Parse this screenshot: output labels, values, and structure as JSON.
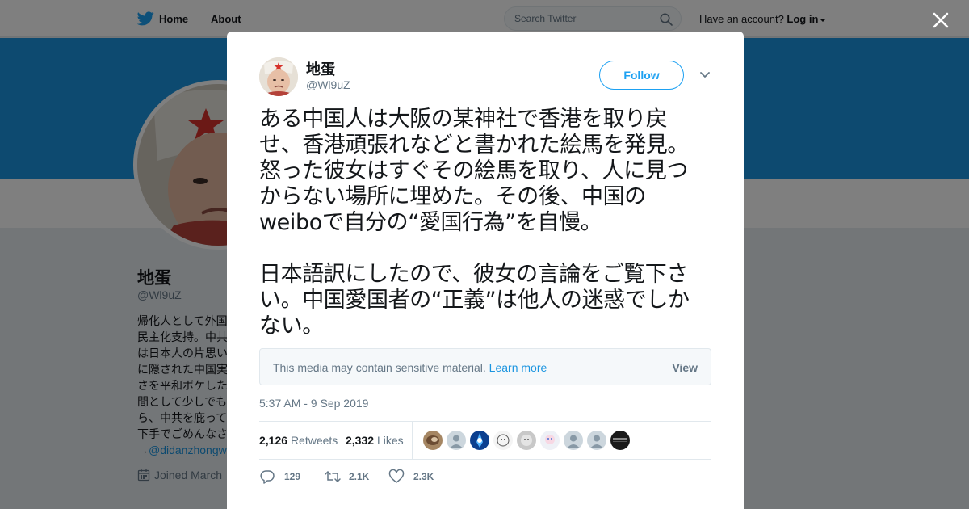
{
  "nav": {
    "home": "Home",
    "about": "About",
    "search_placeholder": "Search Twitter",
    "have_account": "Have an account?",
    "login": "Log in"
  },
  "profile": {
    "name": "地蛋",
    "handle": "@Wl9uZ",
    "bio_lines": [
      "帰化人として外国",
      "民主化支持。中共",
      "は日本人の片思い",
      "に隠された中国実",
      "さを平和ボケした",
      "間として少しでも",
      "ら、中共を庇って",
      "下手でごめんなさ"
    ],
    "bio_link_prefix": "→",
    "bio_link": "@didanzhongw",
    "joined": "Joined March"
  },
  "tweet": {
    "author_name": "地蛋",
    "author_handle": "@Wl9uZ",
    "follow_label": "Follow",
    "lines_para1": [
      "ある中国人は大阪の某神社で香港を取り戻",
      "せ、香港頑張れなどと書かれた絵馬を発見。",
      "怒った彼女はすぐその絵馬を取り、人に見つ",
      "からない場所に埋めた。その後、中国の",
      "weiboで自分の“愛国行為”を自慢。"
    ],
    "lines_para2": [
      "日本語訳にしたので、彼女の言論をご覧下さ",
      "い。中国愛国者の“正義”は他人の迷惑でしか",
      "ない。"
    ],
    "sensitive_notice": "This media may contain sensitive material.",
    "learn_more": "Learn more",
    "view_label": "View",
    "timestamp": "5:37 AM - 9 Sep 2019",
    "retweets_count": "2,126",
    "retweets_label": "Retweets",
    "likes_count": "2,332",
    "likes_label": "Likes",
    "replies_action": "129",
    "retweets_action": "2.1K",
    "likes_action": "2.3K"
  },
  "liker_avatars": [
    {
      "kind": "photo",
      "color": "#8a6a4a"
    },
    {
      "kind": "default",
      "color": "#aab8c2"
    },
    {
      "kind": "blue",
      "color": "#1a6fd6"
    },
    {
      "kind": "sketch",
      "color": "#f0f0f0"
    },
    {
      "kind": "grey",
      "color": "#c9c9c9"
    },
    {
      "kind": "anime",
      "color": "#e8e3f0"
    },
    {
      "kind": "default",
      "color": "#aab8c2"
    },
    {
      "kind": "default",
      "color": "#aab8c2"
    },
    {
      "kind": "dark",
      "color": "#222222"
    }
  ],
  "colors": {
    "brand_blue": "#1da1f2",
    "banner_blue": "#1b95e0",
    "muted_text": "#657786"
  }
}
